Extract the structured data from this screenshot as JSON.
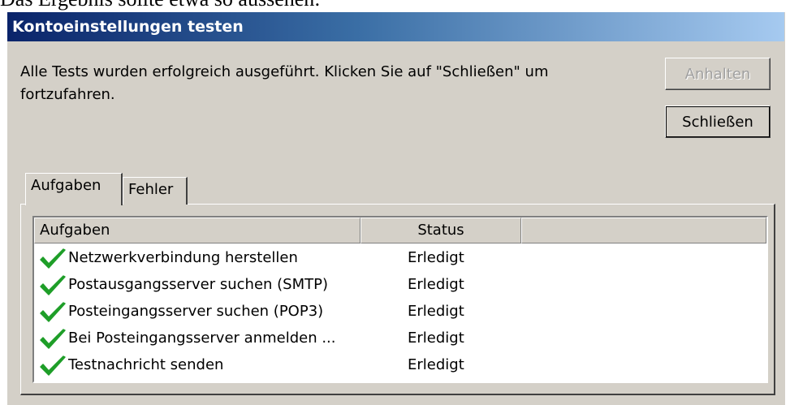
{
  "caption": "Das Ergebnis sollte etwa so aussehen:",
  "dialog": {
    "title": "Kontoeinstellungen testen",
    "message": "Alle Tests wurden erfolgreich ausgeführt. Klicken Sie auf \"Schließen\" um fortzufahren.",
    "buttons": {
      "stop_label": "Anhalten",
      "stop_enabled": false,
      "close_label": "Schließen"
    },
    "tabs": [
      {
        "label": "Aufgaben",
        "active": true
      },
      {
        "label": "Fehler",
        "active": false
      }
    ],
    "table": {
      "columns": [
        "Aufgaben",
        "Status",
        ""
      ],
      "rows": [
        {
          "icon": "check-icon",
          "task": "Netzwerkverbindung herstellen",
          "status": "Erledigt"
        },
        {
          "icon": "check-icon",
          "task": "Postausgangsserver suchen (SMTP)",
          "status": "Erledigt"
        },
        {
          "icon": "check-icon",
          "task": "Posteingangsserver suchen (POP3)",
          "status": "Erledigt"
        },
        {
          "icon": "check-icon",
          "task": "Bei Posteingangsserver anmelden ...",
          "status": "Erledigt"
        },
        {
          "icon": "check-icon",
          "task": "Testnachricht senden",
          "status": "Erledigt"
        }
      ]
    }
  },
  "colors": {
    "title_gradient_start": "#0a246a",
    "title_gradient_end": "#a6caf0",
    "dialog_face": "#d4d0c8",
    "check_green": "#1e9e28"
  }
}
